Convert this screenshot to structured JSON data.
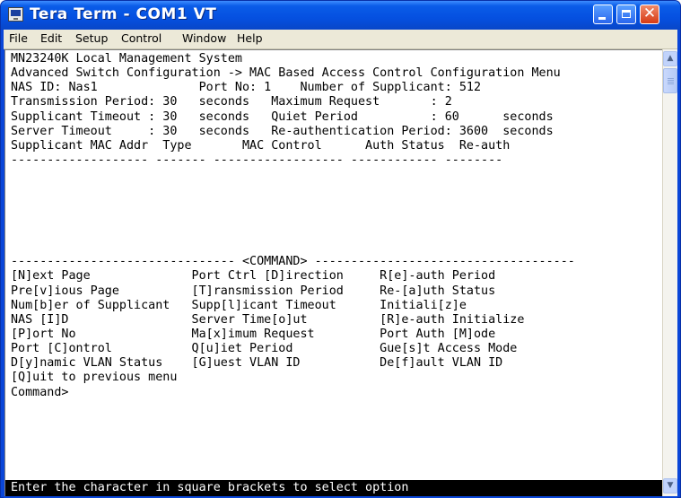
{
  "window": {
    "title": "Tera Term - COM1 VT",
    "title_bar_color": "#0a5ce8",
    "close_button_color": "#d63a14"
  },
  "menu": {
    "items": [
      "File",
      "Edit",
      "Setup",
      "Control",
      "Window",
      "Help"
    ]
  },
  "terminal": {
    "lines": [
      "MN23240K Local Management System",
      "Advanced Switch Configuration -> MAC Based Access Control Configuration Menu",
      "NAS ID: Nas1              Port No: 1    Number of Supplicant: 512",
      "Transmission Period: 30   seconds   Maximum Request       : 2",
      "Supplicant Timeout : 30   seconds   Quiet Period          : 60      seconds",
      "Server Timeout     : 30   seconds   Re-authentication Period: 3600  seconds",
      "Supplicant MAC Addr  Type       MAC Control      Auth Status  Re-auth",
      "------------------- ------- ------------------ ------------ --------",
      "",
      "",
      "",
      "",
      "",
      "",
      "------------------------------- <COMMAND> ------------------------------------",
      "[N]ext Page              Port Ctrl [D]irection     R[e]-auth Period",
      "Pre[v]ious Page          [T]ransmission Period     Re-[a]uth Status",
      "Num[b]er of Supplicant   Supp[l]icant Timeout      Initiali[z]e",
      "NAS [I]D                 Server Time[o]ut          [R]e-auth Initialize",
      "[P]ort No                Ma[x]imum Request         Port Auth [M]ode",
      "Port [C]ontrol           Q[u]iet Period            Gue[s]t Access Mode",
      "D[y]namic VLAN Status    [G]uest VLAN ID           De[f]ault VLAN ID",
      "[Q]uit to previous menu",
      "Command>"
    ],
    "status_line": "Enter the character in square brackets to select option",
    "background_color": "#ffffff",
    "text_color": "#000000",
    "status_background_color": "#000000"
  }
}
